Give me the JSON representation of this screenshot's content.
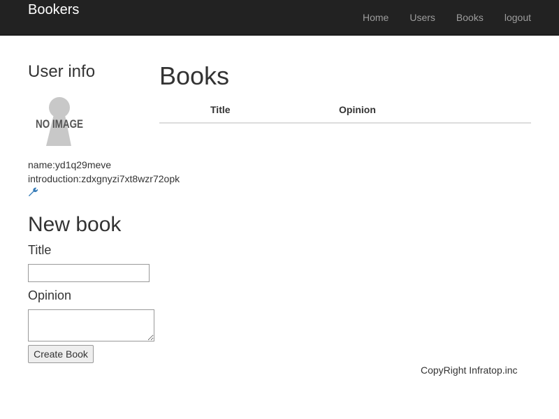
{
  "nav": {
    "brand": "Bookers",
    "links": [
      "Home",
      "Users",
      "Books",
      "logout"
    ]
  },
  "user_info": {
    "heading": "User info",
    "image_text": "NO IMAGE",
    "name": "name:yd1q29meve",
    "introduction": "introduction:zdxgnyzi7xt8wzr72opk"
  },
  "new_book": {
    "heading": "New book",
    "title_label": "Title",
    "title_value": "",
    "opinion_label": "Opinion",
    "opinion_value": "",
    "submit": "Create Book"
  },
  "books": {
    "heading": "Books",
    "columns": [
      "Title",
      "Opinion"
    ]
  },
  "footer": "CopyRight Infratop.inc",
  "colors": {
    "wrench": "#337ab7"
  }
}
